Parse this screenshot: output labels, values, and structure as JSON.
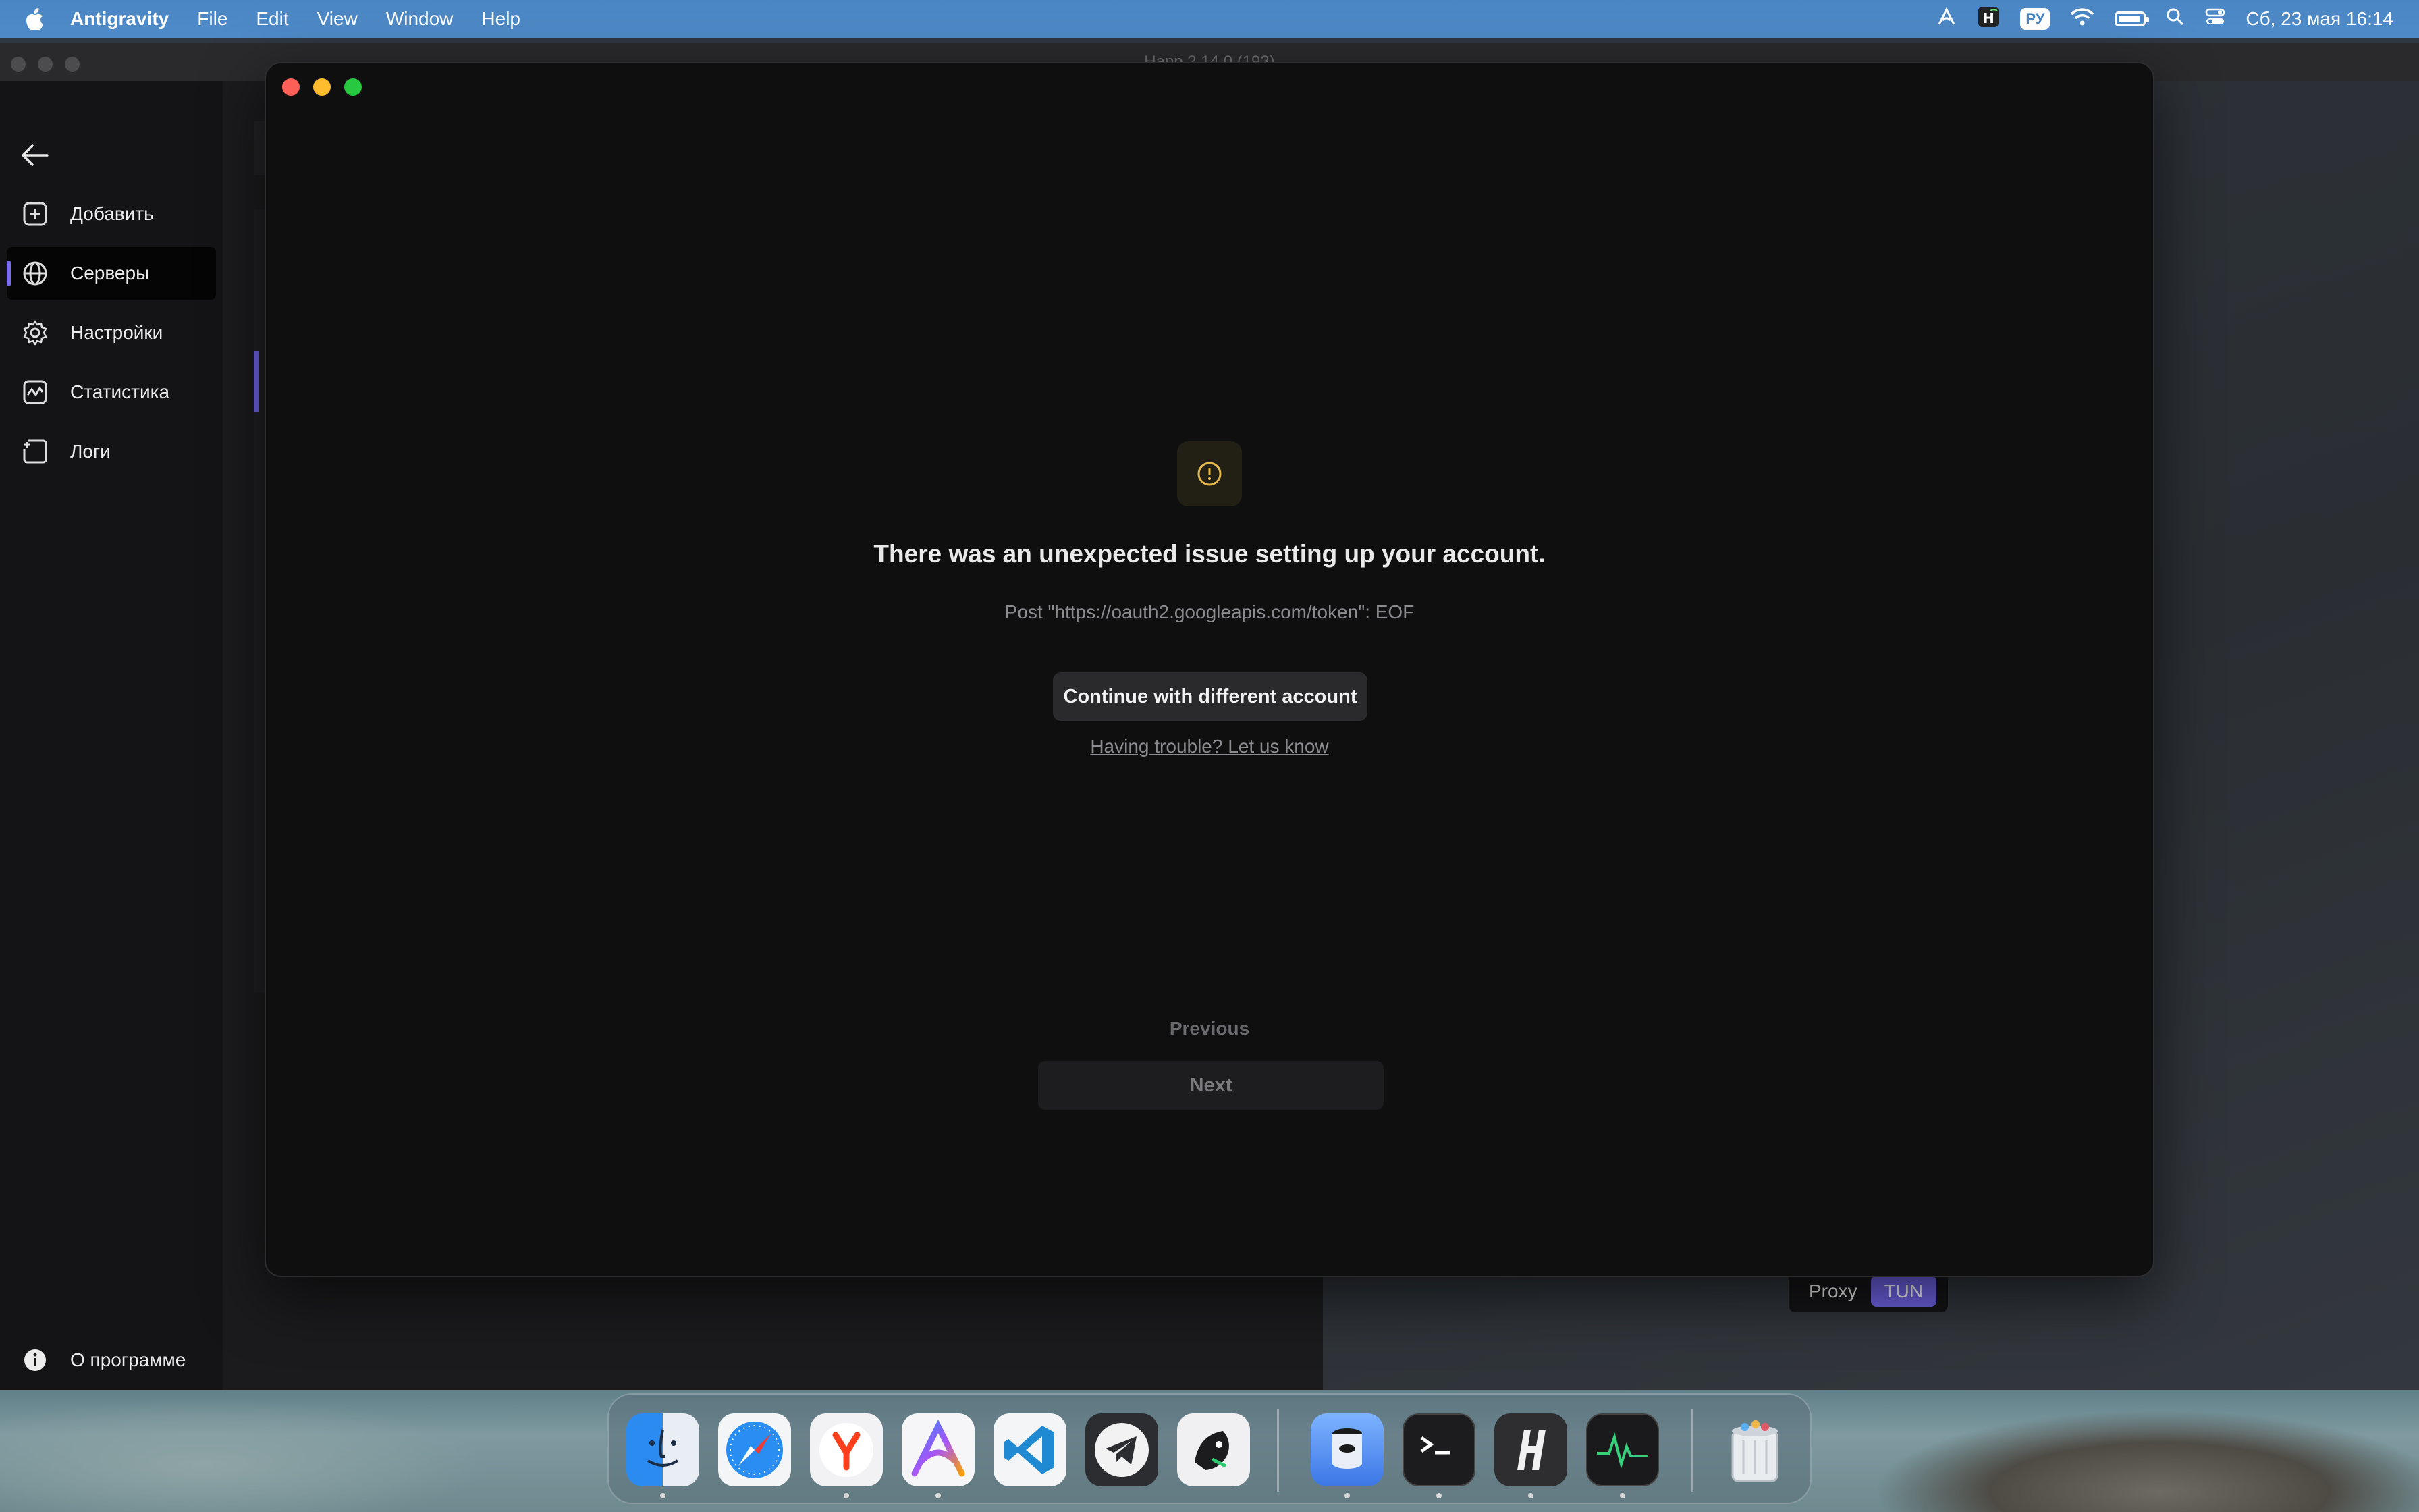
{
  "menubar": {
    "app_name": "Antigravity",
    "menus": [
      "File",
      "Edit",
      "View",
      "Window",
      "Help"
    ],
    "input_lang": "РУ",
    "datetime": "Сб, 23 мая  16:14"
  },
  "happ": {
    "title": "Happ 2.14.0 (193)",
    "sidebar": {
      "items": [
        {
          "label": "Добавить",
          "icon": "plus-square-icon"
        },
        {
          "label": "Серверы",
          "icon": "globe-icon",
          "active": true
        },
        {
          "label": "Настройки",
          "icon": "gear-icon"
        },
        {
          "label": "Статистика",
          "icon": "chart-icon"
        },
        {
          "label": "Логи",
          "icon": "logs-icon"
        }
      ],
      "about": "О программе"
    },
    "mode_toggle": {
      "proxy": "Proxy",
      "tun": "TUN",
      "selected": "TUN"
    }
  },
  "dialog": {
    "title": "There was an unexpected issue setting up your account.",
    "error": "Post \"https://oauth2.googleapis.com/token\": EOF",
    "continue_label": "Continue with different account",
    "trouble_link": "Having trouble? Let us know",
    "previous_label": "Previous",
    "next_label": "Next",
    "warning_color": "#e6b84a"
  },
  "dock": {
    "apps": [
      "finder-icon",
      "safari-icon",
      "yandex-browser-icon",
      "antigravity-icon",
      "vscode-icon",
      "telegram-icon",
      "orca-icon",
      "privacy-icon",
      "terminal-icon",
      "happ-icon",
      "activity-monitor-icon",
      "trash-icon"
    ]
  }
}
